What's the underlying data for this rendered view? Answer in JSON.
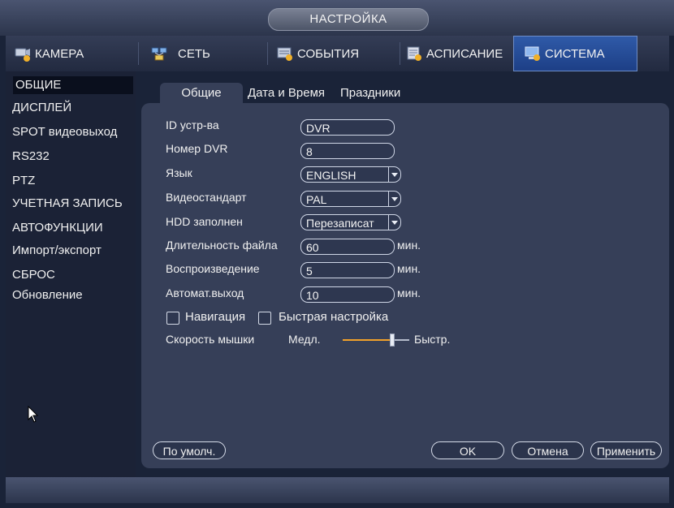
{
  "title": "НАСТРОЙКА",
  "tabs": [
    {
      "label": "КАМЕРА",
      "icon": "camera-icon"
    },
    {
      "label": "СЕТЬ",
      "icon": "network-icon"
    },
    {
      "label": "СОБЫТИЯ",
      "icon": "events-icon"
    },
    {
      "label": "АСПИСАНИЕ",
      "icon": "schedule-icon"
    },
    {
      "label": "СИСТЕМА",
      "icon": "system-icon",
      "active": true
    }
  ],
  "sidebar": {
    "items": [
      {
        "label": "ОБЩИЕ",
        "active": true
      },
      {
        "label": "ДИСПЛЕЙ"
      },
      {
        "label": "SPOT видеовыход"
      },
      {
        "label": "RS232"
      },
      {
        "label": "PTZ"
      },
      {
        "label": "УЧЕТНАЯ ЗАПИСЬ"
      },
      {
        "label": "АВТОФУНКЦИИ"
      },
      {
        "label": "Импорт/экспорт"
      },
      {
        "label": "СБРОС"
      },
      {
        "label": "Обновление"
      }
    ]
  },
  "subtabs": [
    {
      "label": "Общие",
      "active": true
    },
    {
      "label": "Дата и Время"
    },
    {
      "label": "Праздники"
    }
  ],
  "form": {
    "device_id": {
      "label": "ID устр-ва",
      "value": "DVR"
    },
    "dvr_no": {
      "label": "Номер DVR",
      "value": "8"
    },
    "language": {
      "label": "Язык",
      "value": "ENGLISH"
    },
    "video_std": {
      "label": "Видеостандарт",
      "value": "PAL"
    },
    "hdd_full": {
      "label": "HDD заполнен",
      "value": "Перезаписат"
    },
    "pack_duration": {
      "label": "Длительность файла",
      "value": "60",
      "unit": "мин."
    },
    "playback": {
      "label": "Воспроизведение",
      "value": "5",
      "unit": "мин."
    },
    "auto_logout": {
      "label": "Автомат.выход",
      "value": "10",
      "unit": "мин."
    },
    "navigation": {
      "label": "Навигация",
      "checked": false
    },
    "quick_setup": {
      "label": "Быстрая настройка",
      "checked": false
    },
    "mouse_speed": {
      "label": "Скорость мышки",
      "slow": "Медл.",
      "fast": "Быстр.",
      "level": 0.8
    }
  },
  "buttons": {
    "default": "По умолч.",
    "ok": "OK",
    "cancel": "Отмена",
    "apply": "Применить"
  },
  "colors": {
    "active_tab": "#2f5aa8",
    "slider_track": "#f2a12a",
    "panel": "#363f58"
  }
}
